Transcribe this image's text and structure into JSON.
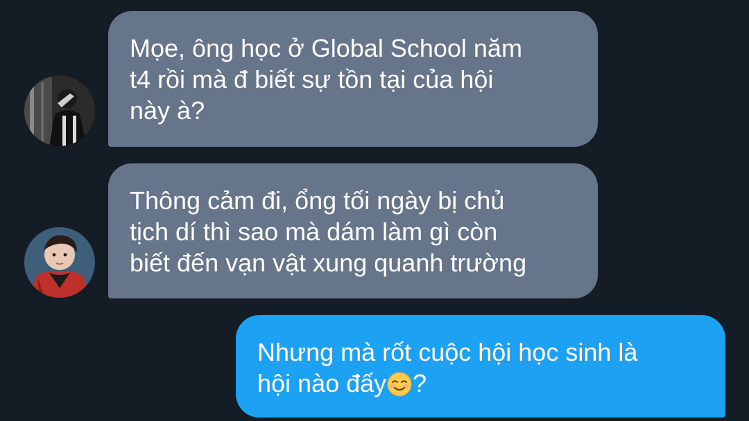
{
  "conversation": {
    "messages": [
      {
        "direction": "incoming",
        "avatar": "avatar-dark-photo",
        "lines": [
          "Mọe, ông học ở Global School năm",
          "t4 rồi mà đ biết sự tồn tại của hội",
          "này à?"
        ]
      },
      {
        "direction": "incoming",
        "avatar": "avatar-red-jacket-photo",
        "lines": [
          "Thông cảm đi, ổng tối ngày bị chủ",
          "tịch dí thì sao mà dám làm gì còn",
          "biết đến vạn vật xung quanh trường"
        ]
      },
      {
        "direction": "outgoing",
        "lines": [
          "Nhưng mà rốt cuộc hội học sinh là",
          "hội nào đấy"
        ],
        "emoji": "smiling-face-emoji",
        "line2_tail": "?"
      }
    ]
  },
  "colors": {
    "background": "#141d26",
    "incoming_bubble": "#66758a",
    "outgoing_bubble": "#1da1f2",
    "text": "#ffffff"
  }
}
